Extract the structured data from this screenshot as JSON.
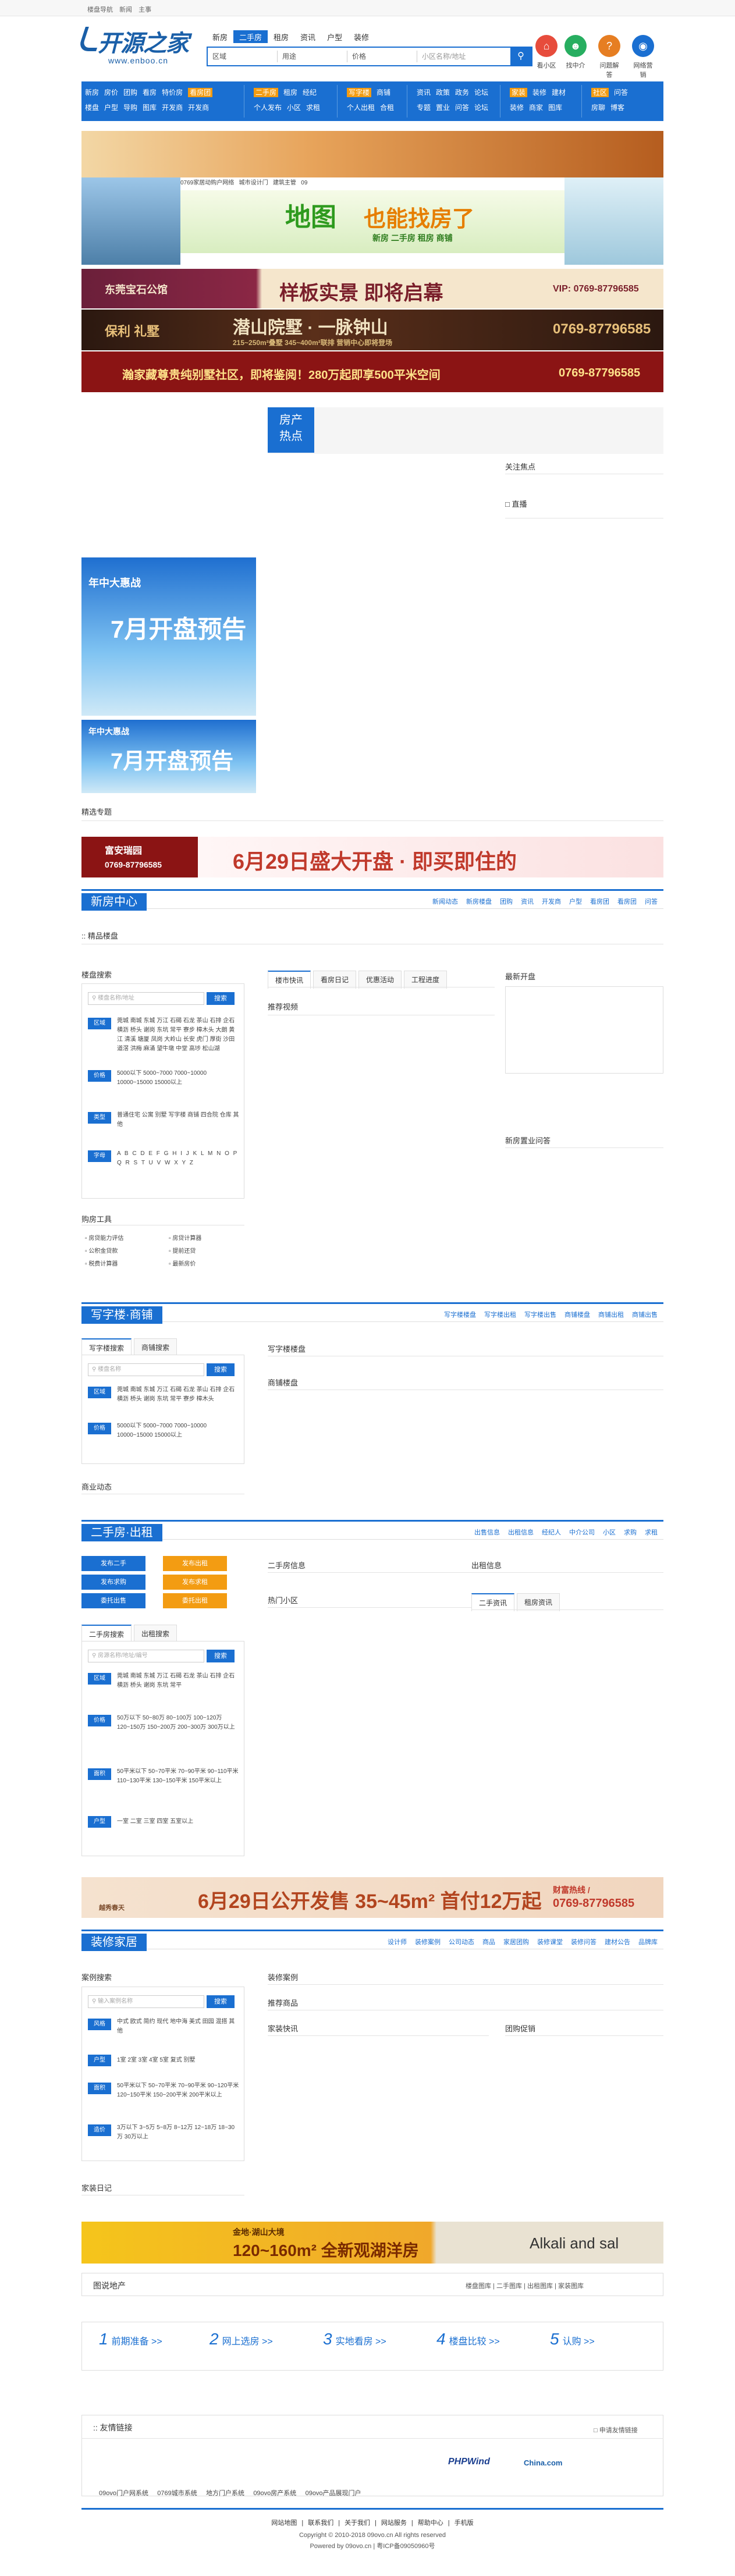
{
  "topbar": {
    "links": [
      "楼盘导航",
      "新闻",
      "主事"
    ]
  },
  "logo": {
    "brand": "开源之家",
    "url": "www.enboo.cn"
  },
  "navtabs": [
    "新房",
    "二手房",
    "租房",
    "资讯",
    "户型",
    "装修"
  ],
  "search": {
    "select1": "区域",
    "select2": "用途",
    "select3": "价格",
    "placeholder": "小区名称/地址",
    "icon": "search-icon"
  },
  "quick": [
    {
      "label": "看小区",
      "color": "#e74c3c"
    },
    {
      "label": "找中介",
      "color": "#27ae60"
    },
    {
      "label": "问题解答",
      "color": "#e67e22"
    },
    {
      "label": "网络营销",
      "color": "#1a6fd1"
    }
  ],
  "mainnav": {
    "g1": {
      "r1": [
        "新房",
        "房价",
        "团购",
        "看房",
        "特价房",
        "看房团"
      ],
      "r2": [
        "楼盘",
        "户型",
        "导购",
        "图库",
        "开发商",
        "开发商"
      ]
    },
    "g2": {
      "r1": [
        "二手房",
        "租房",
        "经纪"
      ],
      "r2": [
        "个人发布",
        "小区",
        "求租"
      ]
    },
    "g3": {
      "r1": [
        "写字楼",
        "商铺"
      ],
      "r2": [
        "个人出租",
        "合租"
      ]
    },
    "g4": {
      "r1": [
        "资讯",
        "政策",
        "政务",
        "论坛"
      ],
      "r2": [
        "专题",
        "置业",
        "问答",
        "论坛"
      ]
    },
    "g5": {
      "r1": [
        "家装",
        "装修",
        "建材"
      ],
      "r2": [
        "装修",
        "商家",
        "图库"
      ]
    },
    "g6": {
      "r1": [
        "社区",
        "问答"
      ],
      "r2": [
        "房聊",
        "博客"
      ]
    }
  },
  "banners": {
    "b2_strip": [
      "0769家居动购户网络",
      "城市设计门",
      "建筑主管",
      "09"
    ],
    "b2_big": "地图",
    "b2_big2": "也能找房了",
    "b2_sub": "新房 二手房 租房 商铺",
    "c_left": "东莞宝石公馆",
    "c_mid": "样板实景 即将启幕",
    "c_right": "VIP: 0769-87796585",
    "d_left": "保利 礼墅",
    "d_mid": "潜山院墅 · 一脉钟山",
    "d_right": "0769-87796585",
    "d_sub": "215~250m²叠墅 345~400m²联排 营销中心即将登场",
    "e_mid": "瀚家藏尊贵纯别墅社区，即将鉴阅！280万起即享500平米空间",
    "e_right": "0769-87796585"
  },
  "hot": {
    "badge1": "房产",
    "badge2": "热点",
    "focus": "关注焦点",
    "live": "直播"
  },
  "side_banners": {
    "t1": "年中大惠战",
    "t2": "7月开盘预告",
    "t3": "年中大惠战",
    "t4": "7月开盘预告"
  },
  "special": {
    "label": "精选专题",
    "banner_left": "富安瑞园",
    "banner_phone": "0769-87796585",
    "banner_main": "6月29日盛大开盘 · 即买即住的"
  },
  "news": {
    "title": "新房中心",
    "links": [
      "新闻动态",
      "新房楼盘",
      "团购",
      "资讯",
      "开发商",
      "户型",
      "看房团",
      "看房团",
      "问答"
    ],
    "jingpin": "精品楼盘",
    "search_title": "楼盘搜索",
    "search_ph": "楼盘名称/地址",
    "search_btn": "搜索",
    "tag_area": "区域",
    "area": "莞城 南城 东城 万江 石碣 石龙 茶山 石排 企石 横沥 桥头 谢岗 东坑 常平 寮步 樟木头 大朗 黄江 清溪 塘厦 凤岗 大岭山 长安 虎门 厚街 沙田 道滘 洪梅 麻涌 望牛墩 中堂 高埗 松山湖",
    "tag_price": "价格",
    "price": "5000以下 5000~7000 7000~10000 10000~15000 15000以上",
    "tag_type": "类型",
    "type": "普通住宅 公寓 别墅 写字楼 商铺 四合院 仓库 其他",
    "tag_letter": "字母",
    "letters": "A B C D E F G H I J K L M N O P Q R S T U V W X Y Z",
    "tools_title": "购房工具",
    "tools": [
      "房贷能力评估",
      "房贷计算器",
      "公积金贷款",
      "提前还贷",
      "税费计算器",
      "最新房价"
    ],
    "tabs": [
      "楼市快讯",
      "看房日记",
      "优惠活动",
      "工程进度"
    ],
    "recommend": "推荐视频",
    "latest": "最新开盘",
    "qa": "新房置业问答"
  },
  "office": {
    "title": "写字楼·商铺",
    "links": [
      "写字楼楼盘",
      "写字楼出租",
      "写字楼出售",
      "商铺楼盘",
      "商铺出租",
      "商铺出售"
    ],
    "tab1": "写字楼搜索",
    "tab2": "商铺搜索",
    "search_ph": "楼盘名称",
    "search_btn": "搜索",
    "tag_area": "区域",
    "tag_price": "价格",
    "area": "莞城 南城 东城 万江 石碣 石龙 茶山 石排 企石 横沥 桥头 谢岗 东坑 常平 寮步 樟木头",
    "price": "5000以下 5000~7000 7000~10000 10000~15000 15000以上",
    "r1": "写字楼楼盘",
    "r2": "商铺楼盘",
    "news": "商业动态"
  },
  "second": {
    "title": "二手房·出租",
    "links": [
      "出售信息",
      "出租信息",
      "经纪人",
      "中介公司",
      "小区",
      "求购",
      "求租"
    ],
    "btn1": "发布二手",
    "btn2": "发布出租",
    "btn3": "发布求购",
    "btn4": "发布求租",
    "btn5": "委托出售",
    "btn6": "委托出租",
    "tab1": "二手房搜索",
    "tab2": "出租搜索",
    "search_ph": "房源名称/地址/编号",
    "search_btn": "搜索",
    "tag_area": "区域",
    "tag_price": "价格",
    "tag_size": "面积",
    "tag_room": "户型",
    "area": "莞城 南城 东城 万江 石碣 石龙 茶山 石排 企石 横沥 桥头 谢岗 东坑 常平",
    "price": "50万以下 50~80万 80~100万 100~120万 120~150万 150~200万 200~300万 300万以上",
    "size": "50平米以下 50~70平米 70~90平米 90~110平米 110~130平米 130~150平米 150平米以上",
    "room": "一室 二室 三室 四室 五室以上",
    "info": "二手房信息",
    "rent": "出租信息",
    "sub1": "二手资讯",
    "sub2": "租房资讯",
    "hot": "热门小区"
  },
  "ad_spring": {
    "brand": "越秀春天",
    "main": "6月29日公开发售 35~45m² 首付12万起",
    "phone_label": "财富热线 /",
    "phone": "0769-87796585"
  },
  "home": {
    "title": "装修家居",
    "links": [
      "设计师",
      "装修案例",
      "公司动态",
      "商品",
      "家居团购",
      "装修课堂",
      "装修问答",
      "建材公告",
      "品牌库"
    ],
    "case": "案例搜索",
    "search_ph": "输入案例名称",
    "search_btn": "搜索",
    "tag_style": "风格",
    "style": "中式 欧式 简约 现代 地中海 美式 田园 混搭 其他",
    "tag_room": "户型",
    "room": "1室 2室 3室 4室 5室 复式 别墅",
    "tag_size": "面积",
    "size": "50平米以下 50~70平米 70~90平米 90~120平米 120~150平米 150~200平米 200平米以上",
    "tag_price": "造价",
    "price": "3万以下 3~5万 5~8万 8~12万 12~18万 18~30万 30万以上",
    "diary": "家装日记",
    "r1": "装修案例",
    "r2": "推荐商品",
    "r3": "家装快讯",
    "r4": "团购促销"
  },
  "ad_lake": {
    "brand": "金地·湖山大境",
    "main": "120~160m² 全新观湖洋房",
    "right": "Alkali and sal"
  },
  "album": {
    "title": "图说地产",
    "links": [
      "楼盘图库",
      "二手图库",
      "出租图库",
      "家装图库"
    ]
  },
  "steps": [
    {
      "n": "1",
      "t": "前期准备 >>"
    },
    {
      "n": "2",
      "t": "网上选房 >>"
    },
    {
      "n": "3",
      "t": "实地看房 >>"
    },
    {
      "n": "4",
      "t": "楼盘比较 >>"
    },
    {
      "n": "5",
      "t": "认购 >>"
    }
  ],
  "friends": {
    "title": "友情链接",
    "apply": "申请友情链接",
    "logo1": "PHPWind",
    "logo2": "China.com",
    "list": [
      "09ovo门户网系统",
      "0769城市系统",
      "地方门户系统",
      "09ovo房产系统",
      "09ovo产品展现门户"
    ]
  },
  "footer": {
    "nav": [
      "网站地图",
      "联系我们",
      "关于我们",
      "网站服务",
      "帮助中心",
      "手机版"
    ],
    "cp1": "Copyright © 2010-2018 09ovo.cn All rights reserved",
    "cp2": "Powered by 09ovo.cn | 粤ICP备09050960号"
  }
}
